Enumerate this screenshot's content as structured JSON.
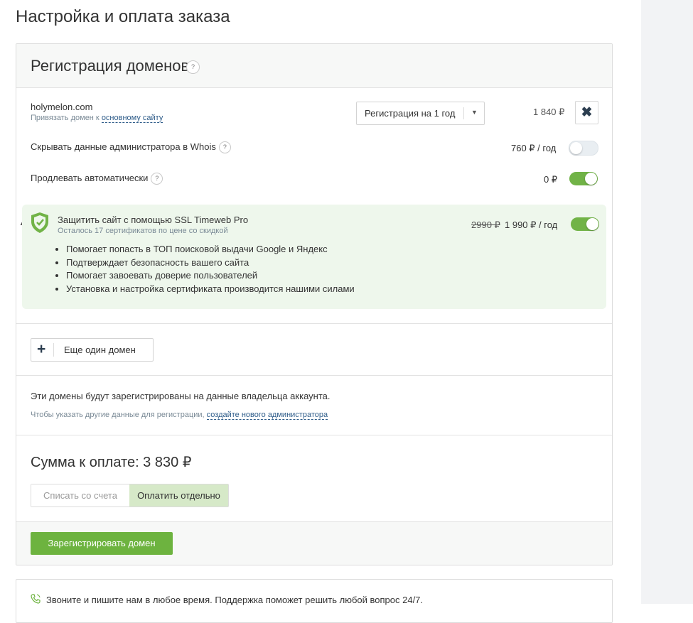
{
  "page": {
    "title": "Настройка и оплата заказа"
  },
  "domains": {
    "title": "Регистрация доменов",
    "help": "?",
    "domain_name": "holymelon.com",
    "bind_prefix": "Привязать домен к ",
    "bind_link": "основному сайту",
    "period_select": "Регистрация на 1 год",
    "price": "1 840 ₽",
    "hide_whois_label": "Скрывать данные администратора в Whois",
    "hide_whois_price": "760 ₽ / год",
    "hide_whois_on": false,
    "autorenew_label": "Продлевать автоматически",
    "autorenew_price": "0 ₽",
    "autorenew_on": true
  },
  "ssl": {
    "title": "Защитить сайт с помощью SSL Timeweb Pro",
    "subtitle": "Осталось 17 сертификатов по цене со скидкой",
    "old_price": "2990 ₽",
    "new_price": "1 990 ₽ / год",
    "enabled": true,
    "benefits": [
      "Помогает попасть в ТОП поисковой выдачи Google и Яндекс",
      "Подтверждает безопасность вашего сайта",
      "Помогает завоевать доверие пользователей",
      "Установка и настройка сертификата производится нашими силами"
    ]
  },
  "add_domain": {
    "label": "Еще один домен"
  },
  "owner_info": {
    "main": "Эти домены будут зарегистрированы на данные владельца аккаунта.",
    "sub_prefix": "Чтобы указать другие данные для регистрации, ",
    "sub_link": "создайте нового администратора"
  },
  "payment": {
    "total": "Сумма к оплате: 3 830 ₽",
    "option_balance": "Списать со счета",
    "option_separate": "Оплатить отдельно",
    "selected": "Оплатить отдельно"
  },
  "submit": {
    "label": "Зарегистрировать домен"
  },
  "support": {
    "text": "Звоните и пишите нам в любое время. Поддержка поможет решить любой вопрос 24/7."
  },
  "colors": {
    "accent_green": "#6db33f",
    "selected_option": "#d6e9c8",
    "ssl_bg": "#eef7ec",
    "link": "#2f5d8a"
  }
}
